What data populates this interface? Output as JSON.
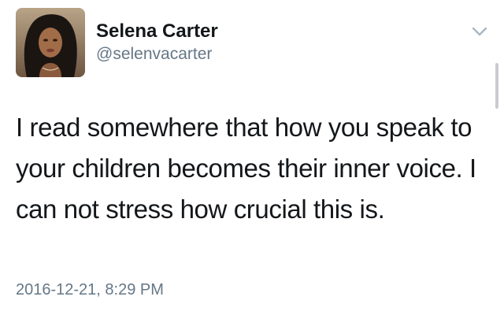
{
  "author": {
    "display_name": "Selena Carter",
    "handle": "@selenvacarter"
  },
  "tweet": {
    "text": "I read somewhere that how you speak to your children becomes their inner voice. I can not stress how crucial this is.",
    "timestamp": "2016-12-21, 8:29 PM"
  },
  "icons": {
    "menu": "chevron-down-icon"
  },
  "colors": {
    "text_primary": "#14171a",
    "text_secondary": "#657786",
    "chevron": "#aab8c2"
  }
}
